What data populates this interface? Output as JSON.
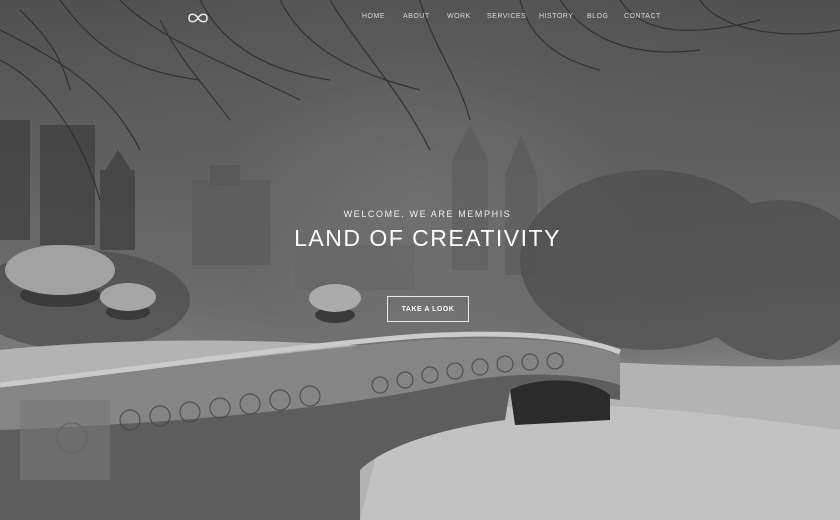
{
  "brand": {
    "logo_icon": "infinity-logo-icon"
  },
  "nav": {
    "items": [
      {
        "label": "HOME"
      },
      {
        "label": "ABOUT"
      },
      {
        "label": "WORK"
      },
      {
        "label": "SERVICES"
      },
      {
        "label": "HISTORY"
      },
      {
        "label": "BLOG"
      },
      {
        "label": "CONTACT"
      }
    ]
  },
  "hero": {
    "eyebrow": "WELCOME. WE ARE MEMPHIS",
    "title": "LAND OF CREATIVITY",
    "cta_label": "TAKE A LOOK",
    "background": "snowy-park-bridge-photo"
  },
  "colors": {
    "text": "#ffffff",
    "nav_text": "#d8d8d8",
    "overlay": "#282828"
  }
}
